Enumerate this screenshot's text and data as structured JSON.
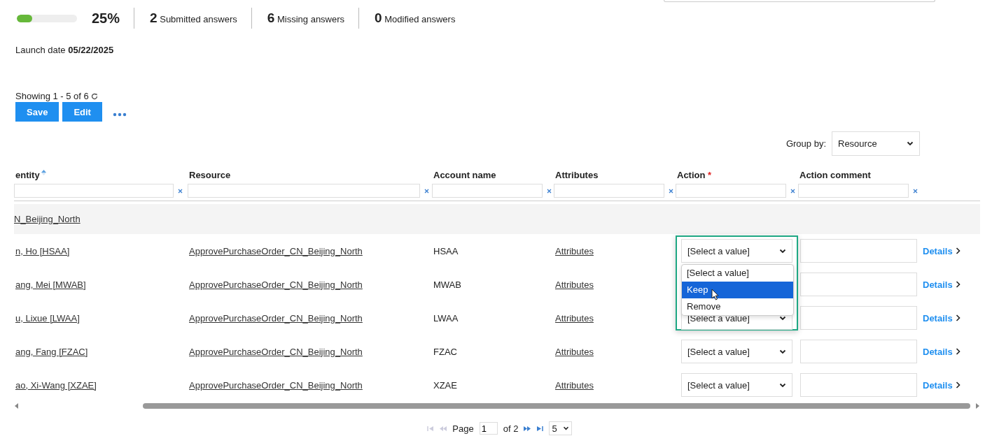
{
  "progress": {
    "level": 0.25,
    "percent": "25%"
  },
  "stats": [
    {
      "count": "2",
      "label": "Submitted answers"
    },
    {
      "count": "6",
      "label": "Missing answers"
    },
    {
      "count": "0",
      "label": "Modified answers"
    }
  ],
  "launch_date": {
    "label": "Launch date",
    "value": "05/22/2025"
  },
  "showing": "Showing 1 - 5 of 6",
  "buttons": [
    "Save",
    "Edit"
  ],
  "group_by": {
    "label": "Group by:",
    "value": "Resource"
  },
  "table": {
    "columns": [
      {
        "label": "entity",
        "sorted": true
      },
      {
        "label": "Resource",
        "sorted": false
      },
      {
        "label": "Account name",
        "sorted": false
      },
      {
        "label": "Attributes",
        "sorted": false
      },
      {
        "label": "Action",
        "sorted": false,
        "required_mark": "*"
      },
      {
        "label": "Action comment",
        "sorted": false
      }
    ],
    "group": "N_Beijing_North",
    "rows": [
      {
        "identity": "n, Ho [HSAA]",
        "resource": "ApprovePurchaseOrder_CN_Beijing_North",
        "account": "HSAA",
        "attributes": "Attributes",
        "action": "[Select a value]",
        "details": "Details",
        "dropdown": {
          "options": [
            {
              "label": "[Select a value]",
              "selected": false
            },
            {
              "label": "Keep",
              "selected": true
            },
            {
              "label": "Remove",
              "selected": false
            }
          ]
        }
      },
      {
        "identity": "ang, Mei [MWAB]",
        "resource": "ApprovePurchaseOrder_CN_Beijing_North",
        "account": "MWAB",
        "attributes": "Attributes",
        "details": "Details"
      },
      {
        "identity": "u, Lixue [LWAA]",
        "resource": "ApprovePurchaseOrder_CN_Beijing_North",
        "account": "LWAA",
        "attributes": "Attributes",
        "action": "[Select a value]",
        "details": "Details"
      },
      {
        "identity": "ang, Fang [FZAC]",
        "resource": "ApprovePurchaseOrder_CN_Beijing_North",
        "account": "FZAC",
        "attributes": "Attributes",
        "action": "[Select a value]",
        "details": "Details"
      },
      {
        "identity": "ao, Xi-Wang [XZAE]",
        "resource": "ApprovePurchaseOrder_CN_Beijing_North",
        "account": "XZAE",
        "attributes": "Attributes",
        "action": "[Select a value]",
        "details": "Details"
      }
    ]
  },
  "pagination": {
    "page_label": "Page",
    "page": "1",
    "of": "of 2",
    "page_size": "5"
  }
}
